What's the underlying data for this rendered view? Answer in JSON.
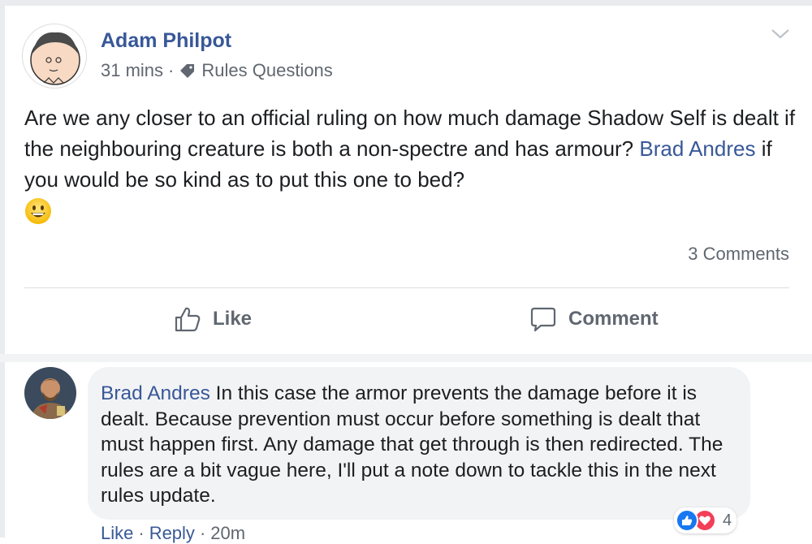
{
  "post": {
    "author": "Adam Philpot",
    "time": "31 mins",
    "meta_separator": "·",
    "group": "Rules Questions",
    "text_before_mention": "Are we any closer to an official ruling on how much damage Shadow Self is dealt if the neighbouring creature is both a non-spectre and has armour? ",
    "mention": "Brad Andres",
    "text_after_mention": " if you would be so kind as to put this one to bed?",
    "emoji": "grinning-face",
    "comments_count": "3 Comments"
  },
  "actions": {
    "like_label": "Like",
    "comment_label": "Comment"
  },
  "comment": {
    "author": "Brad Andres",
    "text": " In this case the armor prevents the damage before it is dealt. Because prevention must occur before something is dealt that must happen first. Any damage that get through is then redirected. The rules are a bit vague here, I'll put a note down to tackle this in the next rules update.",
    "reaction_count": "4",
    "reactions": [
      "like",
      "love"
    ],
    "like_label": "Like",
    "reply_label": "Reply",
    "time": "20m",
    "separator": "·"
  },
  "colors": {
    "link_blue": "#385898",
    "meta_gray": "#606770",
    "bubble_bg": "#f2f3f5",
    "like_blue": "#1877f2",
    "love_red": "#f33e58"
  },
  "icons": {
    "tag": "tag-icon",
    "chevron": "chevron-down-icon",
    "like": "thumbs-up-icon",
    "comment": "speech-bubble-icon"
  }
}
